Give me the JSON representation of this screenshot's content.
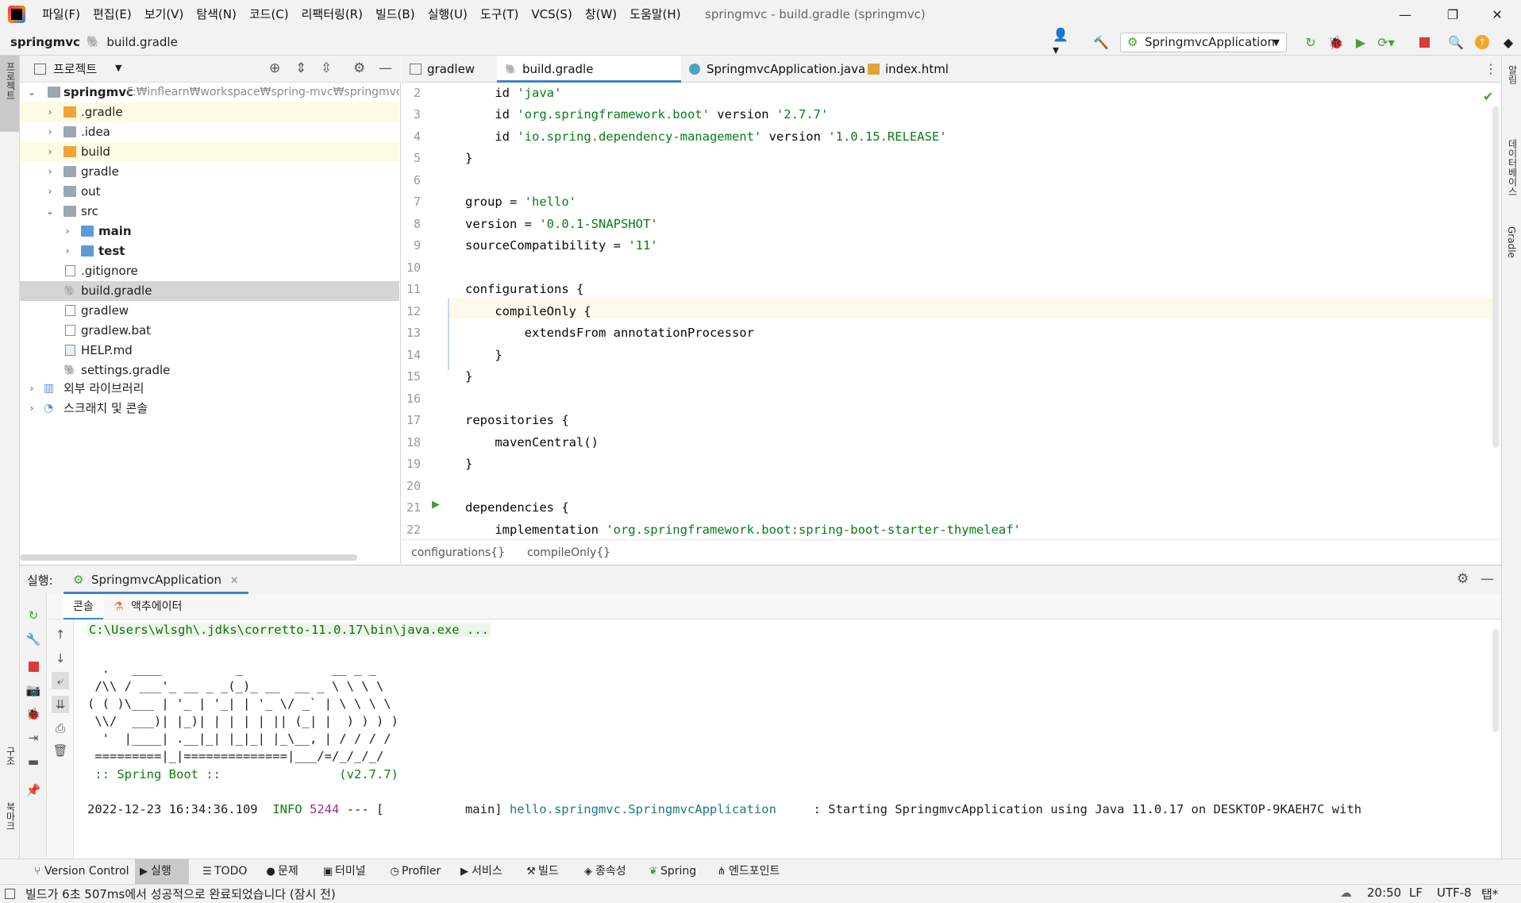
{
  "menu": {
    "items": [
      "파일(F)",
      "편집(E)",
      "보기(V)",
      "탐색(N)",
      "코드(C)",
      "리팩터링(R)",
      "빌드(B)",
      "실행(U)",
      "도구(T)",
      "VCS(S)",
      "창(W)",
      "도움말(H)"
    ],
    "window_title": "springmvc - build.gradle (springmvc)"
  },
  "navbar": {
    "project": "springmvc",
    "file": "build.gradle",
    "run_config": "SpringmvcApplication"
  },
  "project_panel": {
    "title": "프로젝트",
    "root_name": "springmvc",
    "root_path": "F:₩inflearn₩workspace₩spring-mvc₩springmvc₩sp",
    "items": [
      ".gradle",
      ".idea",
      "build",
      "gradle",
      "out",
      "src",
      "main",
      "test",
      ".gitignore",
      "build.gradle",
      "gradlew",
      "gradlew.bat",
      "HELP.md",
      "settings.gradle",
      "외부 라이브러리",
      "스크래치 및 콘솔"
    ]
  },
  "editor": {
    "tabs": [
      "gradlew",
      "build.gradle (springmvc)",
      "SpringmvcApplication.java",
      "index.html"
    ],
    "line_numbers": [
      "2",
      "3",
      "4",
      "5",
      "6",
      "7",
      "8",
      "9",
      "10",
      "11",
      "12",
      "13",
      "14",
      "15",
      "16",
      "17",
      "18",
      "19",
      "20",
      "21",
      "22"
    ],
    "lines": [
      {
        "pre": "    id ",
        "str": "'java'",
        "post": ""
      },
      {
        "pre": "    id ",
        "str": "'org.springframework.boot'",
        "post": " version ",
        "str2": "'2.7.7'"
      },
      {
        "pre": "    id ",
        "str": "'io.spring.dependency-management'",
        "post": " version ",
        "str2": "'1.0.15.RELEASE'"
      },
      {
        "pre": "}",
        "str": "",
        "post": ""
      },
      {
        "pre": "",
        "str": "",
        "post": ""
      },
      {
        "pre": "group = ",
        "str": "'hello'",
        "post": ""
      },
      {
        "pre": "version = ",
        "str": "'0.0.1-SNAPSHOT'",
        "post": ""
      },
      {
        "pre": "sourceCompatibility = ",
        "str": "'11'",
        "post": ""
      },
      {
        "pre": "",
        "str": "",
        "post": ""
      },
      {
        "pre": "configurations {",
        "str": "",
        "post": ""
      },
      {
        "pre": "    compileOnly {",
        "str": "",
        "post": ""
      },
      {
        "pre": "        extendsFrom annotationProcessor",
        "str": "",
        "post": ""
      },
      {
        "pre": "    }",
        "str": "",
        "post": ""
      },
      {
        "pre": "}",
        "str": "",
        "post": ""
      },
      {
        "pre": "",
        "str": "",
        "post": ""
      },
      {
        "pre": "repositories {",
        "str": "",
        "post": ""
      },
      {
        "pre": "    mavenCentral()",
        "str": "",
        "post": ""
      },
      {
        "pre": "}",
        "str": "",
        "post": ""
      },
      {
        "pre": "",
        "str": "",
        "post": ""
      },
      {
        "pre": "dependencies {",
        "str": "",
        "post": ""
      },
      {
        "pre": "    implementation ",
        "str": "'org.springframework.boot:spring-boot-starter-thymeleaf'",
        "post": ""
      }
    ],
    "breadcrumbs": [
      "configurations{}",
      "compileOnly{}"
    ]
  },
  "run_window": {
    "label": "실행:",
    "config_tab": "SpringmvcApplication",
    "subtabs": [
      "콘솔",
      "액추에이터"
    ],
    "console": {
      "command": "C:\\Users\\wlsgh\\.jdks\\corretto-11.0.17\\bin\\java.exe ...",
      "banner": [
        "  .   ____          _            __ _ _",
        " /\\\\ / ___'_ __ _ _(_)_ __  __ _ \\ \\ \\ \\",
        "( ( )\\___ | '_ | '_| | '_ \\/ _` | \\ \\ \\ \\",
        " \\\\/  ___)| |_)| | | | | || (_| |  ) ) ) )",
        "  '  |____| .__|_| |_|_| |_\\__, | / / / /",
        " =========|_|==============|___/=/_/_/_/"
      ],
      "spring_boot": " :: Spring Boot ::                (v2.7.7)",
      "log_time": "2022-12-23 16:34:36.109",
      "log_level": "INFO",
      "log_pid": "5244",
      "log_sep": "--- [           main]",
      "log_class": "hello.springmvc.SpringmvcApplication",
      "log_msg": "     : Starting SpringmvcApplication using Java 11.0.17 on DESKTOP-9KAEH7C with"
    }
  },
  "tool_strip": [
    "Version Control",
    "실행",
    "TODO",
    "문제",
    "터미널",
    "Profiler",
    "서비스",
    "빌드",
    "종속성",
    "Spring",
    "엔드포인트"
  ],
  "status": {
    "message": "빌드가 6초 507ms에서 성공적으로 완료되었습니다 (잠시 전)",
    "position": "20:50",
    "line_sep": "LF",
    "encoding": "UTF-8",
    "indent": "탭*"
  },
  "side_labels": {
    "left_top": "프로젝트",
    "left_mid": "구조",
    "left_bottom": "북마크",
    "right_1": "알림",
    "right_2": "데이터베이스",
    "right_3": "Gradle"
  }
}
